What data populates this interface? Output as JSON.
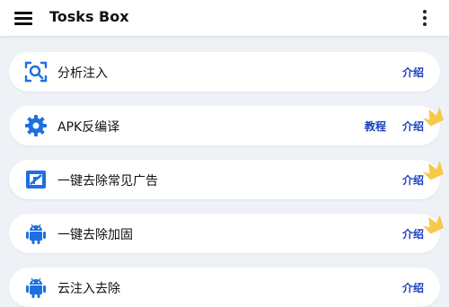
{
  "app": {
    "title": "Tosks Box"
  },
  "colors": {
    "accent": "#1b3fbf",
    "icon_blue": "#1e6fe0",
    "crown": "#f7c948"
  },
  "items": [
    {
      "icon": "scan-search-icon",
      "label": "分析注入",
      "links": [
        "介绍"
      ]
    },
    {
      "icon": "gear-icon",
      "label": "APK反编译",
      "links": [
        "教程",
        "介绍"
      ],
      "badge": "crown-icon"
    },
    {
      "icon": "ad-block-icon",
      "label": "一键去除常见广告",
      "links": [
        "介绍"
      ],
      "badge": "crown-icon"
    },
    {
      "icon": "android-icon",
      "label": "一键去除加固",
      "links": [
        "介绍"
      ],
      "badge": "crown-icon"
    },
    {
      "icon": "android-icon",
      "label": "云注入去除",
      "links": [
        "介绍"
      ]
    }
  ]
}
